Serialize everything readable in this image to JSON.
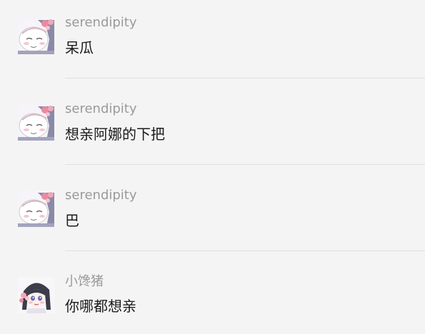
{
  "messages": [
    {
      "user": "serendipity",
      "text": "呆瓜",
      "avatar_icon": "anime-girl-pink-bow-avatar"
    },
    {
      "user": "serendipity",
      "text": "想亲阿娜的下把",
      "avatar_icon": "anime-girl-pink-bow-avatar"
    },
    {
      "user": "serendipity",
      "text": "巴",
      "avatar_icon": "anime-girl-pink-bow-avatar"
    },
    {
      "user": "小馋猪",
      "text": "你哪都想亲",
      "avatar_icon": "anime-girl-dark-hair-avatar"
    }
  ],
  "colors": {
    "background": "#f4f4f4",
    "username": "#9a9a9a",
    "message_text": "#1a1a1a",
    "divider": "#e0e0e0"
  }
}
